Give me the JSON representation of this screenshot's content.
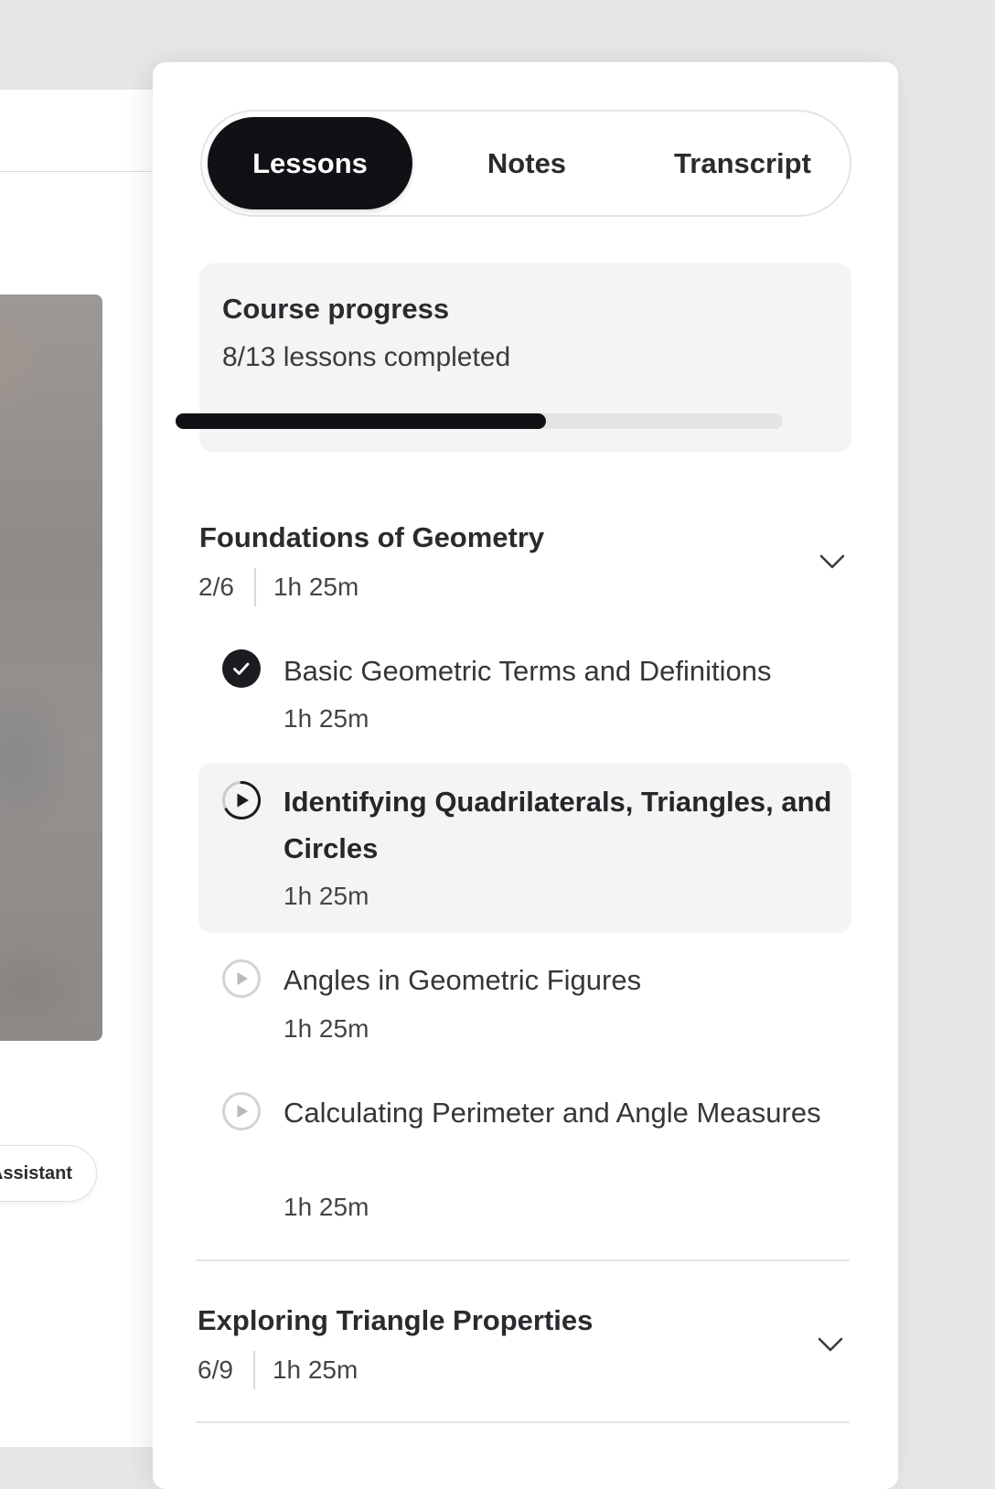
{
  "background": {
    "assistant_label": "Assistant"
  },
  "tabs": [
    {
      "label": "Lessons",
      "active": true
    },
    {
      "label": "Notes",
      "active": false
    },
    {
      "label": "Transcript",
      "active": false
    }
  ],
  "progress": {
    "title": "Course progress",
    "summary": "8/13 lessons completed",
    "fraction": 0.61
  },
  "sections": [
    {
      "title": "Foundations of Geometry",
      "count": "2/6",
      "duration": "1h 25m",
      "expanded": true,
      "lessons": [
        {
          "title": "Basic Geometric Terms and Definitions",
          "duration": "1h 25m",
          "status": "completed"
        },
        {
          "title": "Identifying Quadrilaterals, Triangles, and Circles",
          "duration": "1h 25m",
          "status": "current"
        },
        {
          "title": "Angles in Geometric Figures",
          "duration": "1h 25m",
          "status": "not-started"
        },
        {
          "title": "Calculating Perimeter and Angle Measures",
          "duration": "1h 25m",
          "status": "not-started"
        }
      ]
    },
    {
      "title": "Exploring Triangle Properties",
      "count": "6/9",
      "duration": "1h 25m",
      "expanded": false
    }
  ],
  "icons": {
    "completed": "check-circle-icon",
    "current": "play-circle-active-icon",
    "not_started": "play-circle-icon",
    "expand": "chevron-down-icon"
  },
  "colors": {
    "accent": "#0f1114",
    "card_bg": "#f4f4f4",
    "track": "#e4e4e5"
  }
}
